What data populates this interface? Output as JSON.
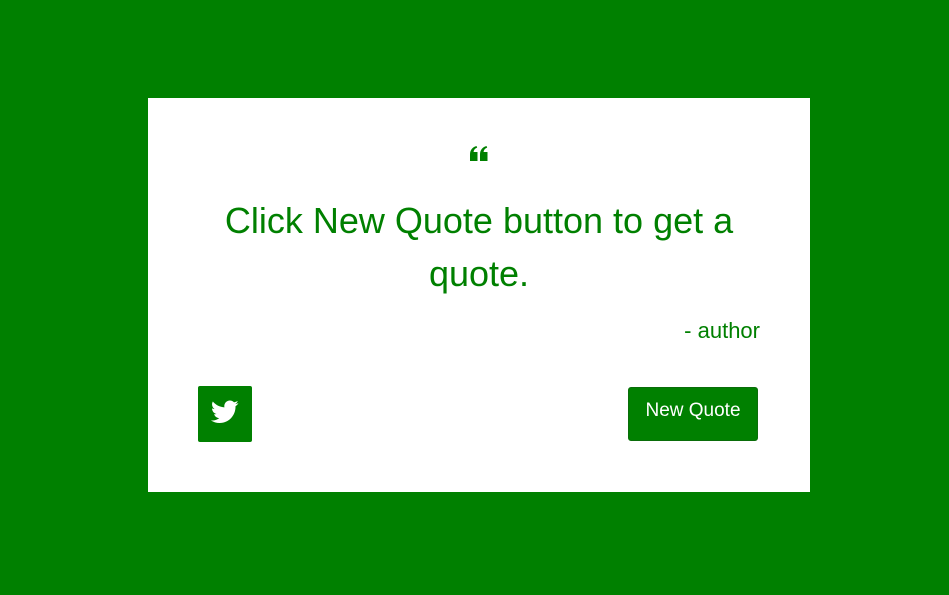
{
  "theme": {
    "accent": "#008000",
    "card_background": "#ffffff",
    "button_text": "#ffffff"
  },
  "quote": {
    "icon": "quote-left-icon",
    "text": "Click New Quote button to get a quote.",
    "author": "- author"
  },
  "actions": {
    "tweet_icon": "twitter-icon",
    "new_quote_label": "New Quote"
  }
}
